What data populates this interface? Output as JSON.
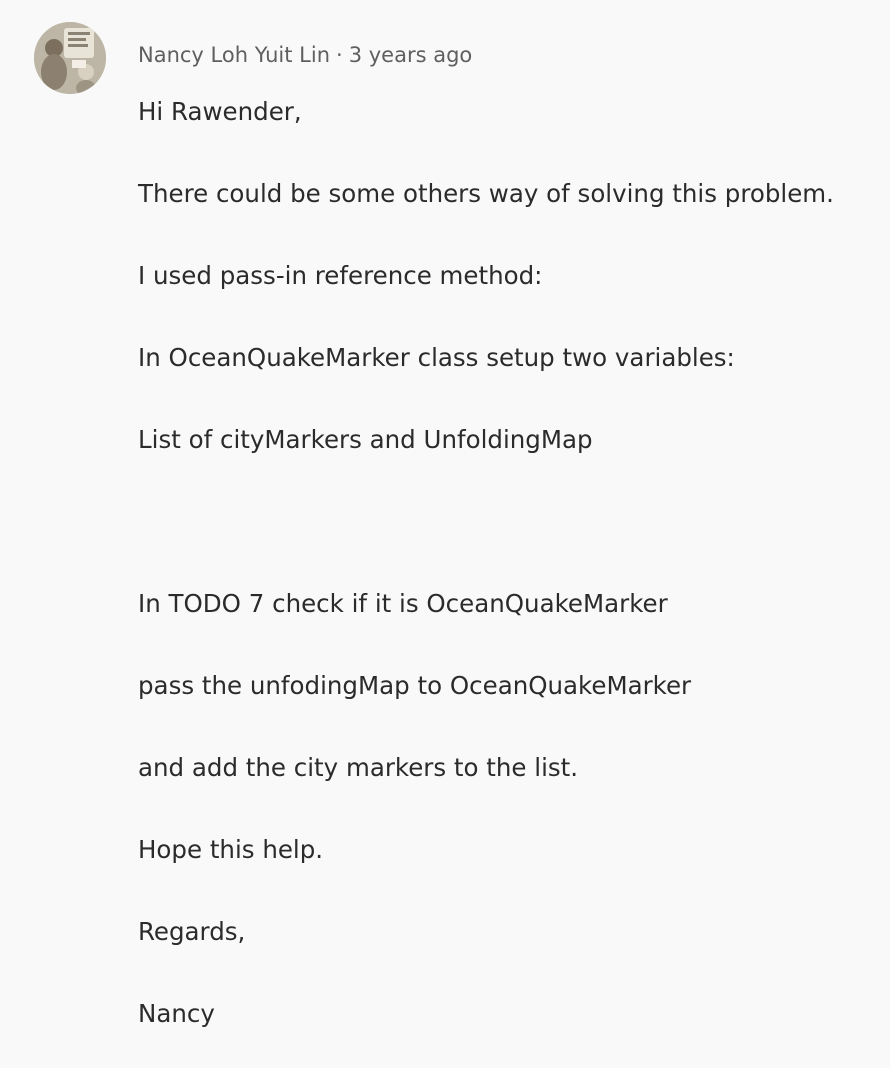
{
  "comment": {
    "author": "Nancy Loh Yuit Lin",
    "separator": "·",
    "timestamp": "3 years ago",
    "avatar_icon": "user-avatar-icon",
    "lines": [
      "Hi Rawender,",
      "There could be some others way of solving this problem.",
      "I used pass-in reference method:",
      "In OceanQuakeMarker class setup two variables:",
      "List of cityMarkers and UnfoldingMap",
      "In TODO 7 check if it is OceanQuakeMarker",
      "pass the unfodingMap to OceanQuakeMarker",
      "and add the city markers to the list.",
      "Hope this help.",
      "Regards,",
      "Nancy"
    ]
  },
  "colors": {
    "background": "#f9f9f9",
    "text": "#2b2b2b",
    "meta_text": "#5f5f5f"
  }
}
